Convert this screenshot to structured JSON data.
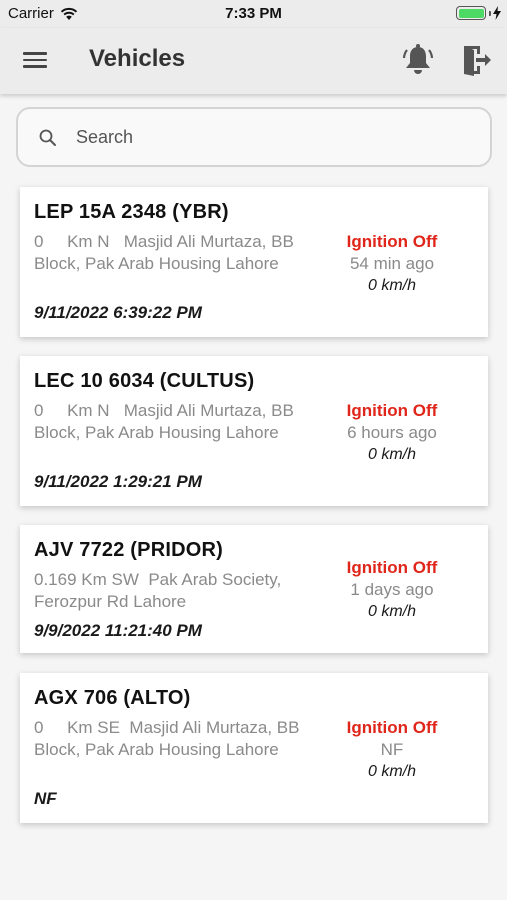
{
  "status_bar": {
    "carrier": "Carrier",
    "time": "7:33 PM"
  },
  "header": {
    "title": "Vehicles",
    "icons": [
      "menu-icon",
      "bell-icon",
      "logout-icon"
    ]
  },
  "search": {
    "placeholder": "Search"
  },
  "colors": {
    "ignition_off": "#e0261b",
    "secondary_text": "#8a8a8a",
    "header_bg": "#ececec"
  },
  "vehicles": [
    {
      "name": "LEP 15A 2348 (YBR)",
      "address": "0     Km N   Masjid Ali Murtaza, BB Block, Pak Arab Housing Lahore",
      "timestamp": "9/11/2022 6:39:22 PM",
      "ignition": "Ignition Off",
      "ago": "54 min ago",
      "speed": "0 km/h"
    },
    {
      "name": "LEC 10 6034 (CULTUS)",
      "address": "0     Km N   Masjid Ali Murtaza, BB Block, Pak Arab Housing Lahore",
      "timestamp": "9/11/2022 1:29:21 PM",
      "ignition": "Ignition Off",
      "ago": "6 hours ago",
      "speed": "0 km/h"
    },
    {
      "name": "AJV 7722 (PRIDOR)",
      "address": "0.169 Km SW  Pak Arab Society, Ferozpur Rd Lahore",
      "timestamp": "9/9/2022 11:21:40 PM",
      "ignition": "Ignition Off",
      "ago": "1 days ago",
      "speed": "0 km/h"
    },
    {
      "name": "AGX 706 (ALTO)",
      "address": "0     Km SE  Masjid Ali Murtaza, BB Block, Pak Arab Housing Lahore",
      "timestamp": "NF",
      "ignition": "Ignition Off",
      "ago": "NF",
      "speed": "0 km/h"
    }
  ]
}
